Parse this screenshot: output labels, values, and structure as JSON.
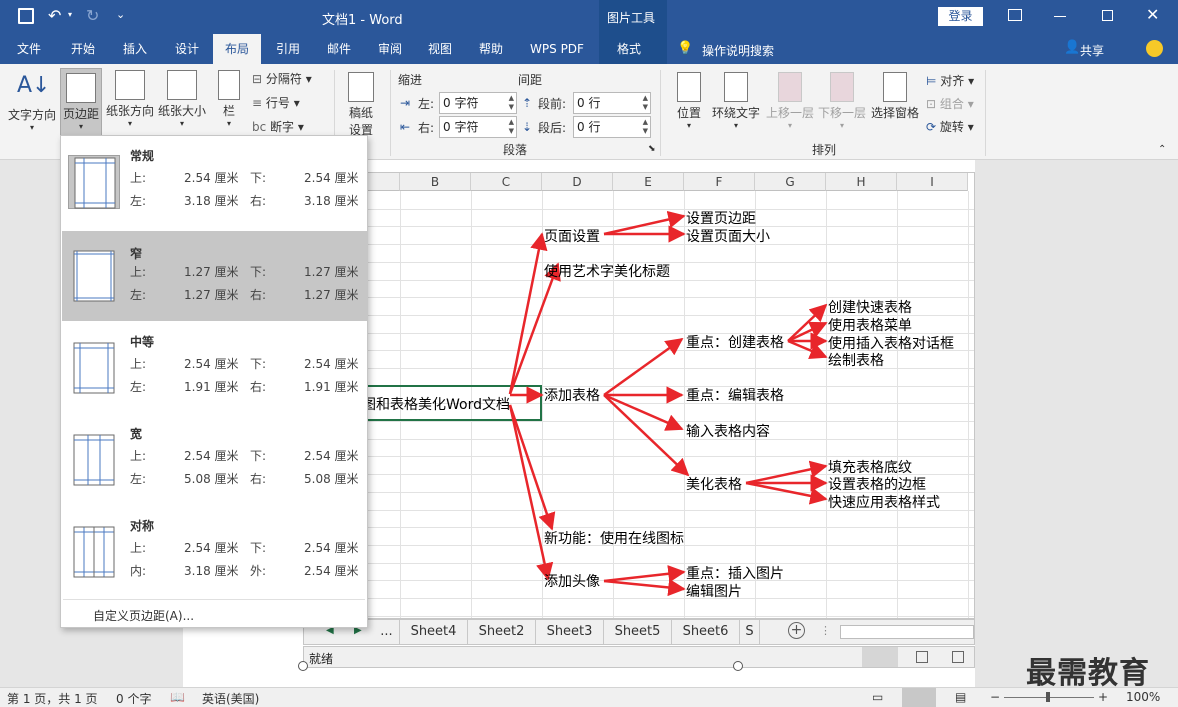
{
  "titlebar": {
    "doc_title": "文档1  -  Word",
    "context_group": "图片工具",
    "login_button": "登录"
  },
  "tabs": [
    "文件",
    "开始",
    "插入",
    "设计",
    "布局",
    "引用",
    "邮件",
    "审阅",
    "视图",
    "帮助",
    "WPS PDF",
    "格式"
  ],
  "active_tab": "布局",
  "tell_me": "操作说明搜索",
  "share": "共享",
  "ribbon": {
    "page_setup": {
      "text_direction": "文字方向",
      "margins": "页边距",
      "orientation": "纸张方向",
      "size": "纸张大小",
      "columns": "栏",
      "breaks": "分隔符",
      "line_numbers": "行号",
      "hyphenation": "断字"
    },
    "draft": {
      "label1": "稿纸",
      "label2": "设置"
    },
    "paragraph": {
      "indent_title": "缩进",
      "spacing_title": "间距",
      "left_label": "左:",
      "left_value": "0 字符",
      "right_label": "右:",
      "right_value": "0 字符",
      "before_label": "段前:",
      "before_value": "0 行",
      "after_label": "段后:",
      "after_value": "0 行",
      "group_label": "段落"
    },
    "arrange": {
      "position": "位置",
      "wrap_text": "环绕文字",
      "bring_forward": "上移一层",
      "send_backward": "下移一层",
      "selection_pane": "选择窗格",
      "align": "对齐",
      "group": "组合",
      "rotate": "旋转",
      "group_label": "排列"
    }
  },
  "margins_menu": {
    "options": [
      {
        "name": "常规",
        "labels": [
          "上:",
          "下:",
          "左:",
          "右:"
        ],
        "values": [
          "2.54 厘米",
          "2.54 厘米",
          "3.18 厘米",
          "3.18 厘米"
        ]
      },
      {
        "name": "窄",
        "labels": [
          "上:",
          "下:",
          "左:",
          "右:"
        ],
        "values": [
          "1.27 厘米",
          "1.27 厘米",
          "1.27 厘米",
          "1.27 厘米"
        ]
      },
      {
        "name": "中等",
        "labels": [
          "上:",
          "下:",
          "左:",
          "右:"
        ],
        "values": [
          "2.54 厘米",
          "2.54 厘米",
          "1.91 厘米",
          "1.91 厘米"
        ]
      },
      {
        "name": "宽",
        "labels": [
          "上:",
          "下:",
          "左:",
          "右:"
        ],
        "values": [
          "2.54 厘米",
          "2.54 厘米",
          "5.08 厘米",
          "5.08 厘米"
        ]
      },
      {
        "name": "对称",
        "labels": [
          "上:",
          "下:",
          "内:",
          "外:"
        ],
        "values": [
          "2.54 厘米",
          "2.54 厘米",
          "3.18 厘米",
          "2.54 厘米"
        ]
      }
    ],
    "selected": "窄",
    "custom": "自定义页边距(A)..."
  },
  "sheet": {
    "columns": [
      "B",
      "C",
      "D",
      "E",
      "F",
      "G",
      "H",
      "I"
    ],
    "tabs": [
      "...",
      "Sheet4",
      "Sheet2",
      "Sheet3",
      "Sheet5",
      "Sheet6",
      "S"
    ],
    "status": "就绪"
  },
  "mindmap": {
    "root": "图和表格美化Word文档",
    "page_setup": "页面设置",
    "set_margins": "设置页边距",
    "set_size": "设置页面大小",
    "wordart": "使用艺术字美化标题",
    "key_create": "重点：创建表格",
    "quick_table": "创建快速表格",
    "table_menu": "使用表格菜单",
    "insert_dialog": "使用插入表格对话框",
    "draw_table": "绘制表格",
    "add_table": "添加表格",
    "key_edit": "重点：编辑表格",
    "input_content": "输入表格内容",
    "beautify": "美化表格",
    "fill_shading": "填充表格底纹",
    "set_border": "设置表格的边框",
    "quick_style": "快速应用表格样式",
    "new_feature": "新功能：使用在线图标",
    "add_avatar": "添加头像",
    "key_insert_pic": "重点：插入图片",
    "edit_pic": "编辑图片"
  },
  "statusbar": {
    "page": "第 1 页，共 1 页",
    "words": "0 个字",
    "language": "英语(美国)",
    "zoom": "100%"
  },
  "watermark": "最需教育",
  "colors": {
    "accent": "#2b579a",
    "arrow": "#e8262b",
    "selected_bg": "#c6c6c6"
  }
}
